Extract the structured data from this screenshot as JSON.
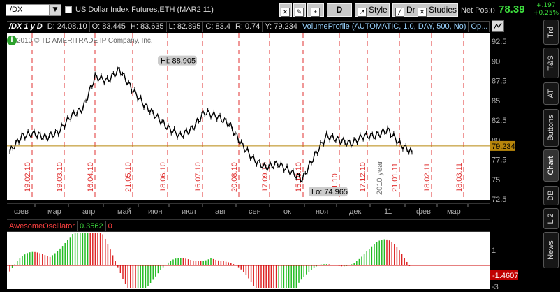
{
  "toolbar": {
    "symbol": "/DX",
    "description": "US Dollar Index Futures,ETH (MAR2 11)",
    "style_label": "Style",
    "drawings_label": "Drawings",
    "studies_label": "Studies",
    "period_label": "D",
    "net_pos_label": "Net Pos:",
    "net_pos_value": "0",
    "last_price": "78.39",
    "change_net": "+.197",
    "change_pct": "+0.25%"
  },
  "infobar": {
    "symbol_period": "/DX 1 y D",
    "date": "D: 24.08.10",
    "open": "O: 83.445",
    "high": "H: 83.635",
    "low": "L: 82.895",
    "close": "C: 83.4",
    "range": "R: 0.74",
    "y": "Y: 79.234",
    "volume_profile": "VolumeProfile (AUTOMATIC, 1.0, DAY, 500, No)",
    "more": "Op..."
  },
  "copyright": "2010 © TD AMERITRADE IP Company, Inc.",
  "annotations": {
    "hi": "Hi: 88.905",
    "lo": "Lo: 74.965",
    "year_label": "2010 year",
    "cursor_price": "79.234"
  },
  "expiration_dates": [
    "19.02.10",
    "19.03.10",
    "16.04.10",
    "21.05.10",
    "18.06.10",
    "16.07.10",
    "20.08.10",
    "17.09.10",
    "15.10.10",
    "11.10",
    "17.12.10",
    "21.01.11",
    "18.02.11",
    "18.03.11"
  ],
  "months": [
    "фев",
    "мар",
    "апр",
    "май",
    "июн",
    "июл",
    "авг",
    "сен",
    "окт",
    "ноя",
    "дек",
    "11",
    "фев",
    "мар"
  ],
  "price_axis": [
    "92.5",
    "90",
    "87.5",
    "85",
    "82.5",
    "80",
    "77.5",
    "75",
    "72.5"
  ],
  "ao": {
    "name": "AwesomeOscillator",
    "value": "0.3562",
    "zero": "0",
    "axis_top": "1",
    "axis_bottom": "-3",
    "current": "-1.4607"
  },
  "side_tabs": [
    "Trd",
    "T&S",
    "AT",
    "Buttons",
    "Chart",
    "DB",
    "L 2",
    "News"
  ],
  "chart_data": {
    "type": "line",
    "title": "US Dollar Index Futures,ETH (MAR2 11)",
    "xlabel": "",
    "ylabel": "",
    "ylim": [
      72.5,
      92.5
    ],
    "x": [
      "фев",
      "мар",
      "апр",
      "май",
      "июн",
      "июл",
      "авг",
      "сен",
      "окт",
      "ноя",
      "дек",
      "11",
      "фев"
    ],
    "series": [
      {
        "values": [
          78.5,
          80.5,
          80.8,
          80.3,
          81.0,
          83.0,
          84.0,
          88.0,
          87.5,
          88.9,
          86.5,
          84.5,
          83.0,
          81.5,
          80.5,
          81.5,
          83.5,
          83.0,
          82.0,
          79.5,
          77.5,
          76.5,
          77.0,
          76.0,
          75.0,
          78.0,
          80.5,
          80.0,
          79.5,
          80.5,
          80.5,
          81.3,
          79.5,
          78.4
        ]
      }
    ],
    "hi": 88.905,
    "lo": 74.965,
    "grid": false
  }
}
